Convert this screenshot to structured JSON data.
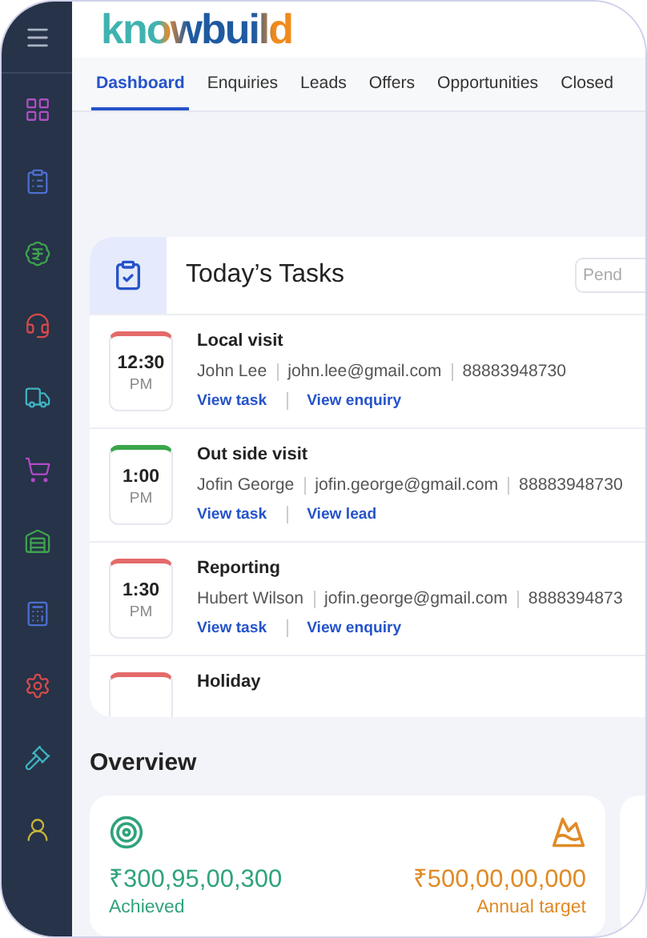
{
  "logo": "knowbuild",
  "tabs": [
    {
      "label": "Dashboard",
      "selected": true
    },
    {
      "label": "Enquiries",
      "selected": false
    },
    {
      "label": "Leads",
      "selected": false
    },
    {
      "label": "Offers",
      "selected": false
    },
    {
      "label": "Opportunities",
      "selected": false
    },
    {
      "label": "Closed",
      "selected": false
    }
  ],
  "tasks_card": {
    "title": "Today’s Tasks",
    "filter": {
      "placeholder": "Pend"
    },
    "tasks": [
      {
        "time": "12:30",
        "period": "PM",
        "title": "Local visit",
        "contact": "John Lee",
        "email": "john.lee@gmail.com",
        "phone": "88883948730",
        "links": [
          "View task",
          "View enquiry"
        ],
        "color": "#e46a6a"
      },
      {
        "time": "1:00",
        "period": "PM",
        "title": "Out side visit",
        "contact": "Jofin George",
        "email": "jofin.george@gmail.com",
        "phone": "88883948730",
        "links": [
          "View task",
          "View lead"
        ],
        "color": "#3aa64a"
      },
      {
        "time": "1:30",
        "period": "PM",
        "title": "Reporting",
        "contact": "Hubert Wilson",
        "email": "jofin.george@gmail.com",
        "phone": "8888394873",
        "links": [
          "View task",
          "View enquiry"
        ],
        "color": "#e46a6a"
      },
      {
        "title": "Holiday",
        "color": "#e46a6a"
      }
    ]
  },
  "overview": {
    "title": "Overview",
    "achieved": {
      "value": "₹300,95,00,300",
      "label": "Achieved"
    },
    "target": {
      "value": "₹500,00,00,000",
      "label": "Annual target"
    }
  }
}
